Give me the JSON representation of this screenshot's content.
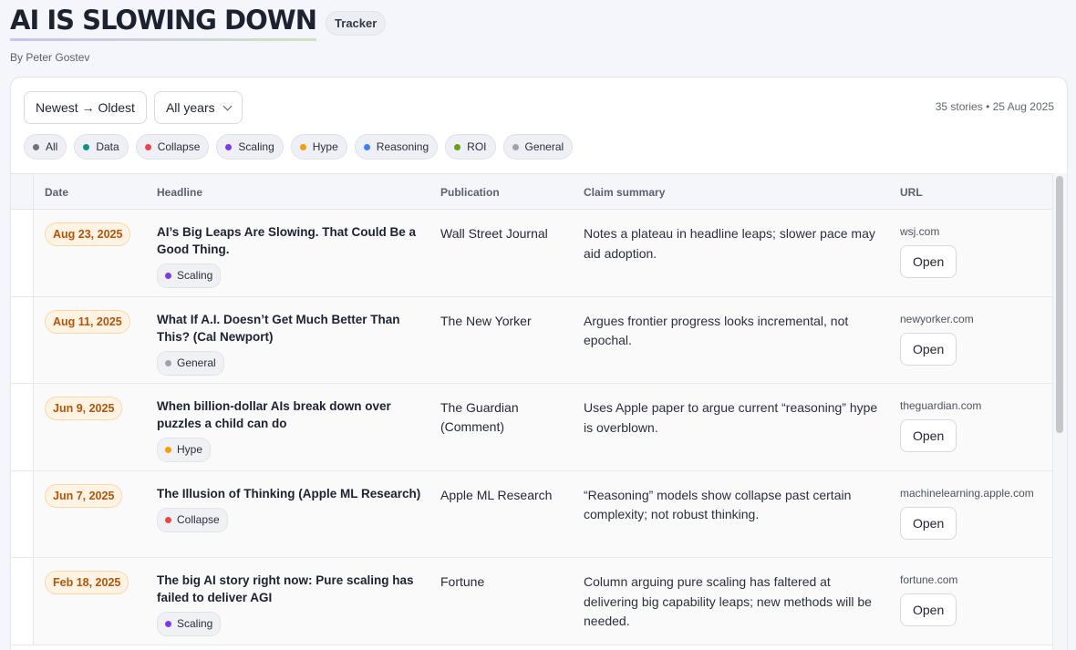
{
  "header": {
    "title": "AI IS SLOWING DOWN",
    "badge": "Tracker",
    "byline": "By Peter Gostev"
  },
  "controls": {
    "sort_label": "Newest → Oldest",
    "year_select": "All years",
    "meta": "35 stories • 25 Aug 2025"
  },
  "filters": [
    {
      "label": "All",
      "color": "#6b7280"
    },
    {
      "label": "Data",
      "color": "#0d9488"
    },
    {
      "label": "Collapse",
      "color": "#ef4444"
    },
    {
      "label": "Scaling",
      "color": "#7c3aed"
    },
    {
      "label": "Hype",
      "color": "#f59e0b"
    },
    {
      "label": "Reasoning",
      "color": "#3b82f6"
    },
    {
      "label": "ROI",
      "color": "#65a30d"
    },
    {
      "label": "General",
      "color": "#9ca3af"
    }
  ],
  "table": {
    "columns": [
      "Date",
      "Headline",
      "Publication",
      "Claim summary",
      "URL"
    ],
    "rows": [
      {
        "date": "Aug 23, 2025",
        "headline": "AI’s Big Leaps Are Slowing. That Could Be a Good Thing.",
        "tag": "Scaling",
        "tag_color": "#7c3aed",
        "publication": "Wall Street Journal",
        "claim": "Notes a plateau in headline leaps; slower pace may aid adoption.",
        "url": "wsj.com",
        "action": "Open"
      },
      {
        "date": "Aug 11, 2025",
        "headline": "What If A.I. Doesn’t Get Much Better Than This? (Cal Newport)",
        "tag": "General",
        "tag_color": "#9ca3af",
        "publication": "The New Yorker",
        "claim": "Argues frontier progress looks incremental, not epochal.",
        "url": "newyorker.com",
        "action": "Open"
      },
      {
        "date": "Jun 9, 2025",
        "headline": "When billion-dollar AIs break down over puzzles a child can do",
        "tag": "Hype",
        "tag_color": "#f59e0b",
        "publication": "The Guardian (Comment)",
        "claim": "Uses Apple paper to argue current “reasoning” hype is overblown.",
        "url": "theguardian.com",
        "action": "Open"
      },
      {
        "date": "Jun 7, 2025",
        "headline": "The Illusion of Thinking (Apple ML Research)",
        "tag": "Collapse",
        "tag_color": "#ef4444",
        "publication": "Apple ML Research",
        "claim": "“Reasoning” models show collapse past certain complexity; not robust thinking.",
        "url": "machinelearning.apple.com",
        "action": "Open"
      },
      {
        "date": "Feb 18, 2025",
        "headline": "The big AI story right now: Pure scaling has failed to deliver AGI",
        "tag": "Scaling",
        "tag_color": "#7c3aed",
        "publication": "Fortune",
        "claim": "Column arguing pure scaling has faltered at delivering big capability leaps; new methods will be needed.",
        "url": "fortune.com",
        "action": "Open"
      }
    ]
  }
}
